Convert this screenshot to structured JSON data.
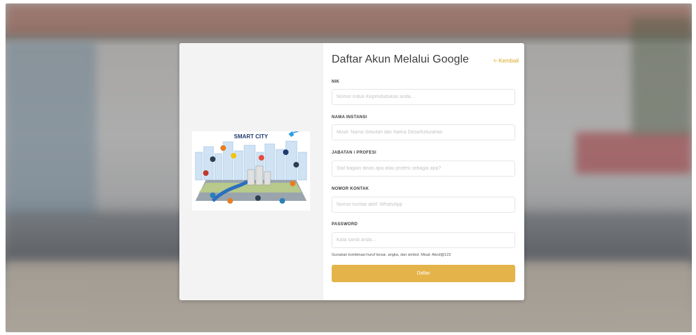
{
  "form": {
    "title": "Daftar Akun Melalui Google",
    "back_label": "Kembali",
    "fields": [
      {
        "label": "NIK",
        "placeholder": "Nomor Induk Kependudukan anda..."
      },
      {
        "label": "NAMA INSTANSI",
        "placeholder": "Misal: Nama Sekolah dan Nama Desa/Kelurahan"
      },
      {
        "label": "JABATAN / PROFESI",
        "placeholder": "Staf bagian dinas apa atau profesi sebagai apa?"
      },
      {
        "label": "NOMOR KONTAK",
        "placeholder": "Nomor kontak aktif: WhatsApp"
      },
      {
        "label": "PASSWORD",
        "placeholder": "Kata sandi anda..."
      }
    ],
    "password_hint": "Gunakan kombinasi huruf besar, angka, dan simbol. Misal: Abcd@123",
    "submit_label": "Daftar"
  },
  "illustration": {
    "title": "SMART CITY"
  },
  "colors": {
    "accent": "#e4b44a",
    "link": "#d9a820",
    "modal_left_bg": "#f3f3f3"
  }
}
